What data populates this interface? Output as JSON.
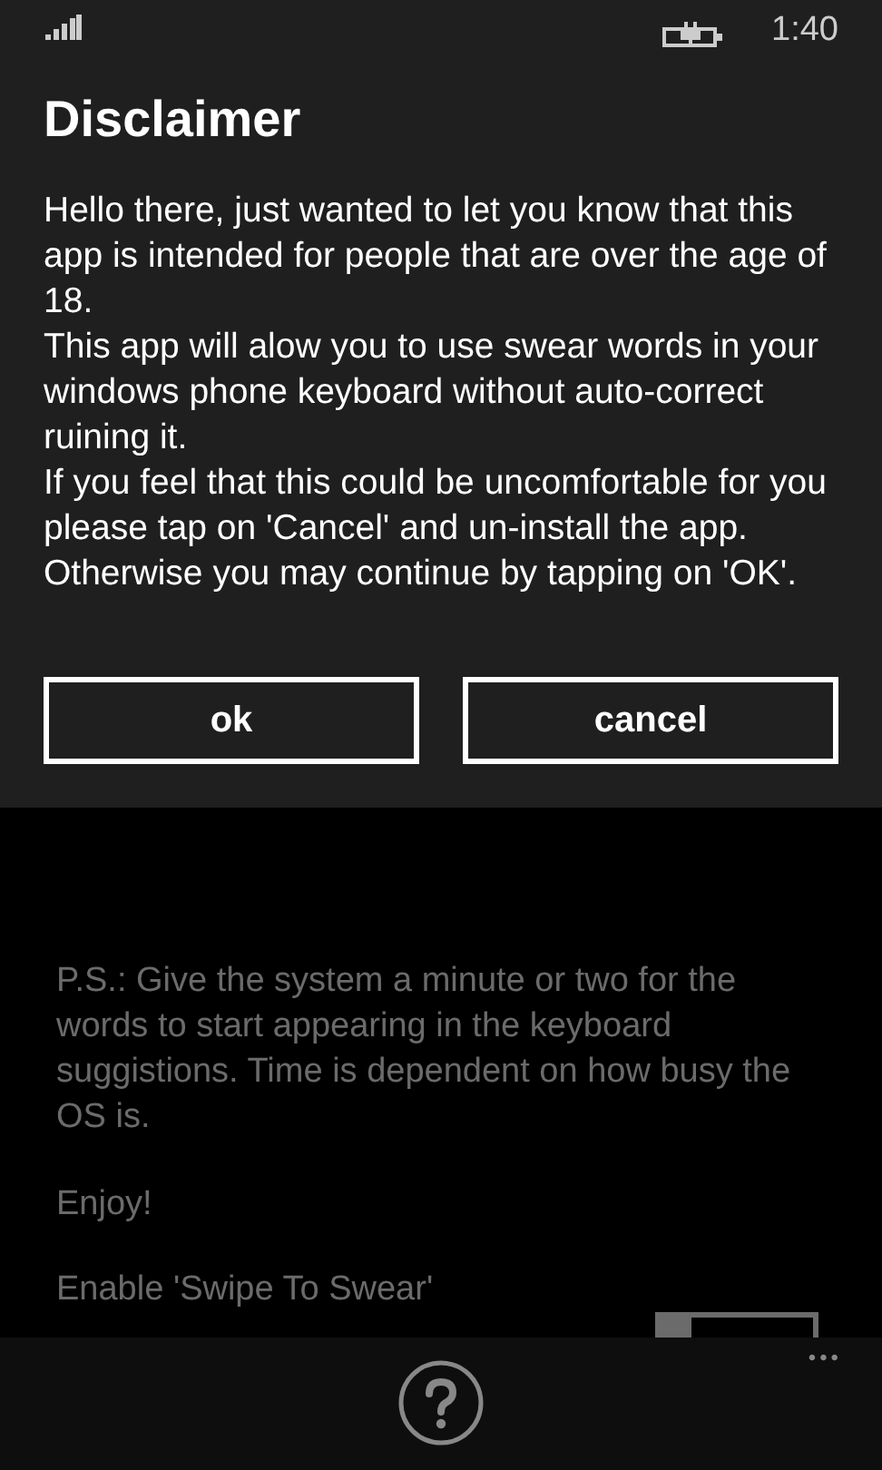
{
  "status_bar": {
    "time": "1:40"
  },
  "dialog": {
    "title": "Disclaimer",
    "paragraphs": [
      "Hello there, just wanted to let you know that this app is intended for people that are over the age of 18.",
      "This app will alow you to use swear words in your windows phone keyboard without auto-correct ruining it.",
      "If you feel that this could be uncomfortable for you please tap on 'Cancel' and un-install the app. Otherwise you may continue by tapping on 'OK'."
    ],
    "buttons": [
      "ok",
      "cancel"
    ]
  },
  "page": {
    "paragraphs": [
      "P.S.: Give the system a minute or two for the words to start appearing in the keyboard suggistions. Time is dependent on how busy the OS is.",
      "Enjoy!"
    ],
    "toggle": {
      "label": "Enable 'Swipe To Swear'",
      "on": false
    }
  },
  "app_bar": {
    "more": "•••"
  }
}
